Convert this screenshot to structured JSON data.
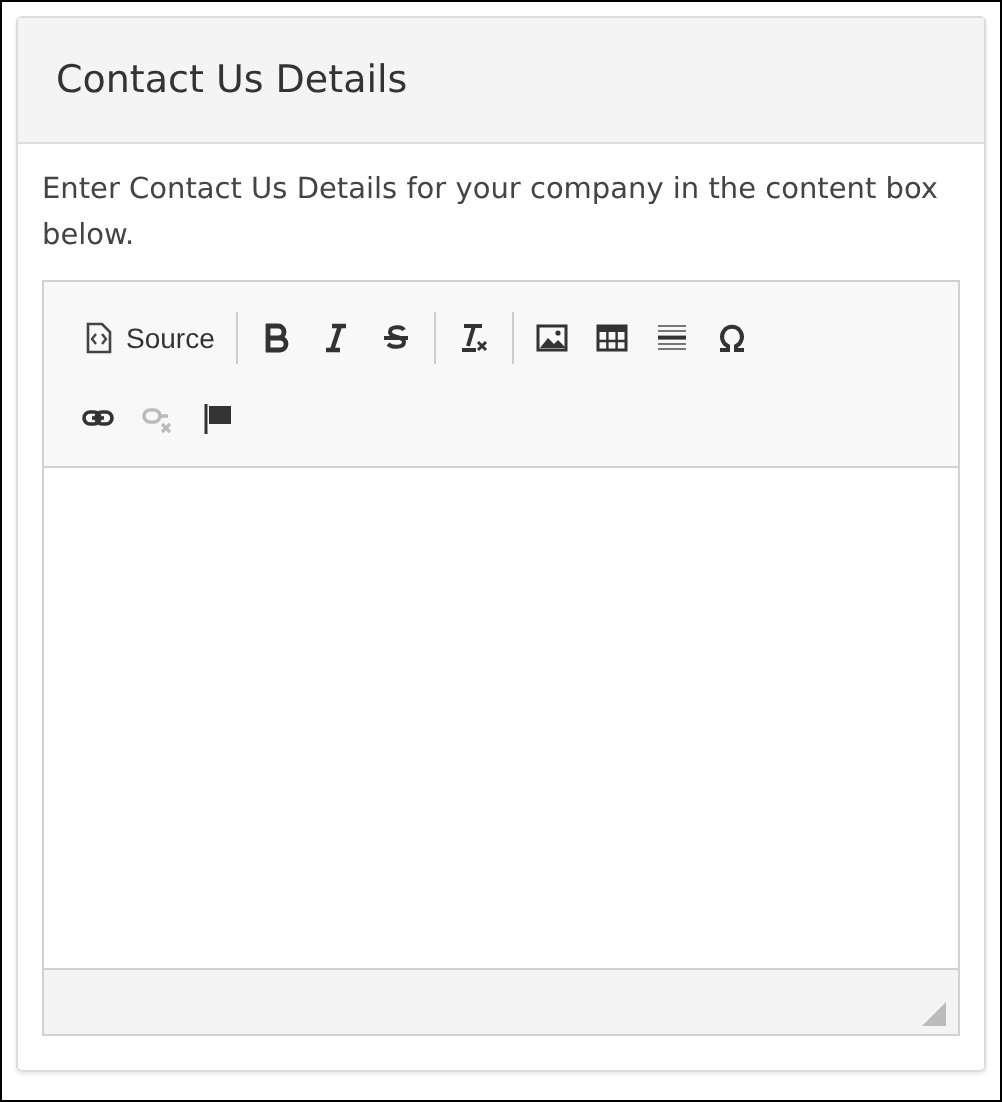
{
  "panel": {
    "title": "Contact Us Details"
  },
  "instructions": "Enter Contact Us Details for your company in the content box below.",
  "editor": {
    "toolbar_rows": [
      [
        [
          {
            "kind": "source",
            "label": "Source",
            "disabled": false
          }
        ],
        [
          {
            "kind": "bold",
            "disabled": false
          },
          {
            "kind": "italic",
            "disabled": false
          },
          {
            "kind": "strike",
            "disabled": false
          }
        ],
        [
          {
            "kind": "clear-format",
            "disabled": false
          }
        ],
        [
          {
            "kind": "image",
            "disabled": false
          },
          {
            "kind": "table",
            "disabled": false
          },
          {
            "kind": "hline",
            "disabled": false
          },
          {
            "kind": "omega",
            "disabled": false
          }
        ]
      ],
      [
        [
          {
            "kind": "link",
            "disabled": false
          },
          {
            "kind": "unlink",
            "disabled": true
          },
          {
            "kind": "anchor",
            "disabled": false
          }
        ]
      ]
    ]
  }
}
